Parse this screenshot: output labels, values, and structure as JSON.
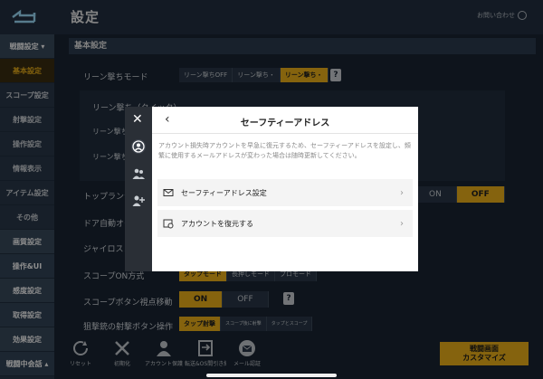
{
  "header": {
    "title": "設定",
    "help_label": "お問い合わせ"
  },
  "sidebar": {
    "items": [
      {
        "label": "戦闘設定 ▾",
        "kind": "group"
      },
      {
        "label": "基本設定",
        "kind": "active"
      },
      {
        "label": "スコープ設定",
        "kind": "normal"
      },
      {
        "label": "射撃設定",
        "kind": "normal"
      },
      {
        "label": "操作設定",
        "kind": "normal"
      },
      {
        "label": "情報表示",
        "kind": "normal"
      },
      {
        "label": "アイテム設定",
        "kind": "normal"
      },
      {
        "label": "その他",
        "kind": "normal"
      },
      {
        "label": "画質設定",
        "kind": "group"
      },
      {
        "label": "操作&UI",
        "kind": "group"
      },
      {
        "label": "感度設定",
        "kind": "group"
      },
      {
        "label": "取得設定",
        "kind": "group"
      },
      {
        "label": "効果設定",
        "kind": "group"
      },
      {
        "label": "戦闘中会話 ▴",
        "kind": "group"
      }
    ]
  },
  "main": {
    "section_title": "基本設定",
    "lean_mode": {
      "label": "リーン撃ちモード",
      "options": [
        "リーン撃ちOFF",
        "リーン撃ち・",
        "リーン撃ち・"
      ],
      "selected": 2
    },
    "lean_sub_label": "リーン撃ち（クイック）",
    "lean_sub2_label": "リーン撃ち 視点移動",
    "lean_sub3_label": "リーン撃ち スコープ",
    "toprun_label": "トップランナー",
    "toprun_options": [
      "ON",
      "OFF"
    ],
    "door_label": "ドア自動オープン",
    "gyro_label": "ジャイロスコープ",
    "scope_on_label": "スコープON方式",
    "scope_on_options": [
      "タップモード",
      "長押しモード",
      "プロモード"
    ],
    "scope_btn_label": "スコープボタン視点移動",
    "scope_btn_options": [
      "ON",
      "OFF"
    ],
    "fire_label": "狙撃銃の射撃ボタン操作",
    "fire_options": [
      "タップ射撃",
      "スコープ後に射撃",
      "タップとスコープ"
    ]
  },
  "dialog": {
    "title": "セーフティーアドレス",
    "back_glyph": "‹",
    "description": "アカウント損失時アカウントを早急に復元するため、セーフティーアドレスを設定し、頻繁に使用するメールアドレスが変わった場合は随時更新してください。",
    "rows": [
      {
        "label": "セーフティーアドレス設定",
        "icon": "mail-settings-icon"
      },
      {
        "label": "アカウントを復元する",
        "icon": "restore-account-icon"
      }
    ],
    "close_glyph": "✕"
  },
  "toolbar": {
    "items": [
      {
        "label": "リセット",
        "icon": "reset-icon"
      },
      {
        "label": "初期化",
        "icon": "tools-icon"
      },
      {
        "label": "アカウント保護",
        "icon": "account-icon"
      },
      {
        "label": "転送&OS間引き継ぎ",
        "icon": "transfer-icon"
      },
      {
        "label": "メール認証",
        "icon": "mail-icon"
      }
    ],
    "custom_line1": "戦闘画面",
    "custom_line2": "カスタマイズ"
  },
  "colors": {
    "accent": "#f2b51a",
    "background": "#1a2533",
    "dialog": "#ffffff"
  }
}
